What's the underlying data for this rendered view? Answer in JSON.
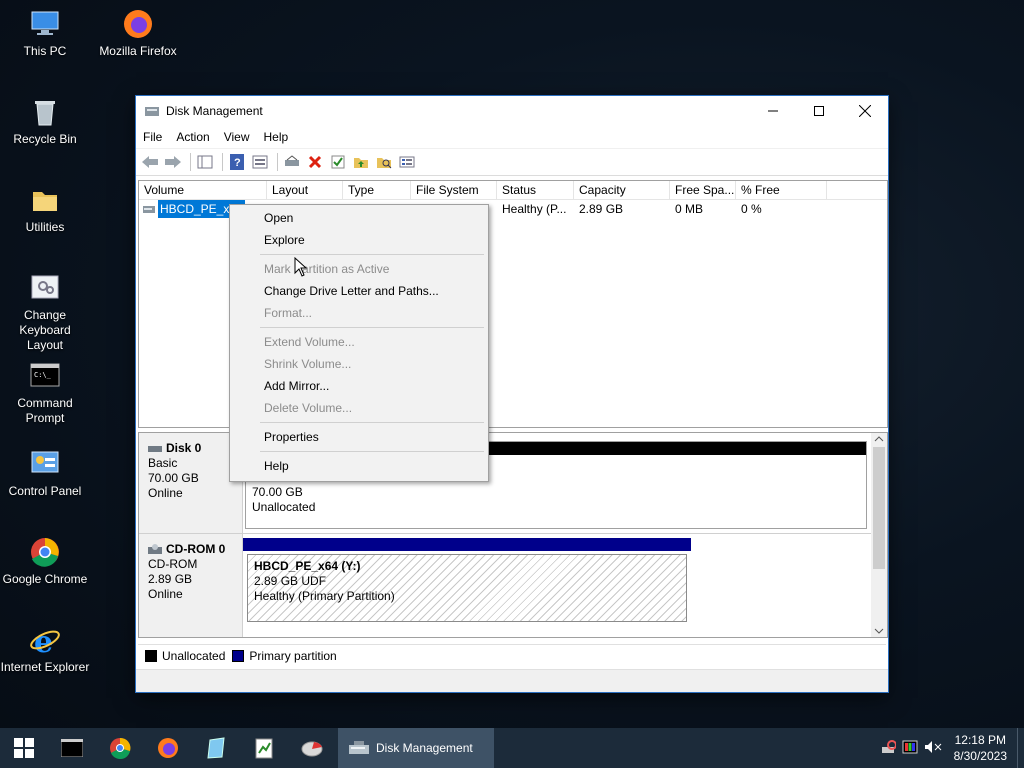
{
  "desktop": {
    "icons": [
      {
        "label": "This PC"
      },
      {
        "label": "Mozilla Firefox"
      },
      {
        "label": "Recycle Bin"
      },
      {
        "label": "Utilities"
      },
      {
        "label": "Change Keyboard Layout"
      },
      {
        "label": "Command Prompt"
      },
      {
        "label": "Control Panel"
      },
      {
        "label": "Google Chrome"
      },
      {
        "label": "Internet Explorer"
      }
    ]
  },
  "window": {
    "title": "Disk Management",
    "menu": [
      "File",
      "Action",
      "View",
      "Help"
    ],
    "columns": [
      "Volume",
      "Layout",
      "Type",
      "File System",
      "Status",
      "Capacity",
      "Free Spa...",
      "% Free"
    ],
    "rows": [
      {
        "volume": "HBCD_PE_x64",
        "status": "Healthy (P...",
        "capacity": "2.89 GB",
        "free": "0 MB",
        "pct_free": "0 %"
      }
    ],
    "disks": [
      {
        "name": "Disk 0",
        "type": "Basic",
        "size": "70.00 GB",
        "state": "Online",
        "partition": {
          "size": "70.00 GB",
          "label": "Unallocated"
        }
      },
      {
        "name": "CD-ROM 0",
        "type": "CD-ROM",
        "size": "2.89 GB",
        "state": "Online",
        "partition": {
          "name": "HBCD_PE_x64  (Y:)",
          "size": "2.89 GB UDF",
          "status": "Healthy (Primary Partition)"
        }
      }
    ],
    "legend": [
      {
        "label": "Unallocated",
        "color": "#000000"
      },
      {
        "label": "Primary partition",
        "color": "#00008b"
      }
    ]
  },
  "context_menu": {
    "items": [
      {
        "label": "Open",
        "enabled": true
      },
      {
        "label": "Explore",
        "enabled": true
      },
      {
        "label": "Mark Partition as Active",
        "enabled": false
      },
      {
        "label": "Change Drive Letter and Paths...",
        "enabled": true
      },
      {
        "label": "Format...",
        "enabled": false
      },
      {
        "label": "Extend Volume...",
        "enabled": false
      },
      {
        "label": "Shrink Volume...",
        "enabled": false
      },
      {
        "label": "Add Mirror...",
        "enabled": true
      },
      {
        "label": "Delete Volume...",
        "enabled": false
      },
      {
        "label": "Properties",
        "enabled": true
      },
      {
        "label": "Help",
        "enabled": true
      }
    ]
  },
  "taskbar": {
    "active_task": "Disk Management",
    "time": "12:18 PM",
    "date": "8/30/2023"
  },
  "colors": {
    "accent": "#0078d7",
    "primary_partition": "#00008b",
    "unallocated": "#000000"
  }
}
